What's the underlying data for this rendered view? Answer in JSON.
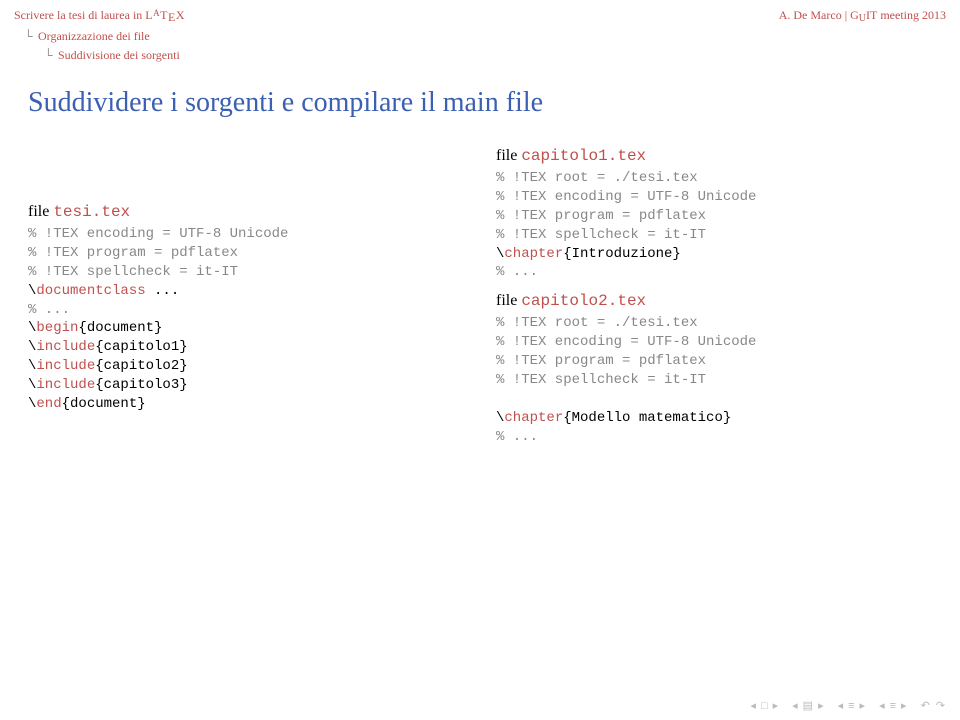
{
  "header": {
    "left_prefix": "Scrivere la tesi di laurea in ",
    "latex": "LATEX",
    "right": "A. De Marco | GuIT meeting 2013"
  },
  "breadcrumb": {
    "level1": "Organizzazione dei file",
    "level2": "Suddivisione dei sorgenti"
  },
  "title": "Suddividere i sorgenti e compilare il main file",
  "left": {
    "file_label": "file ",
    "file_name": "tesi.tex",
    "code_lines": [
      {
        "t": "% !TEX encoding = UTF-8 Unicode",
        "cls": "c-grey"
      },
      {
        "t": "% !TEX program = pdflatex",
        "cls": "c-grey"
      },
      {
        "t": "% !TEX spellcheck = it-IT",
        "cls": "c-grey"
      },
      {
        "pre": "\\",
        "cmd": "documentclass",
        "post": " ...",
        "cls": "c-red"
      },
      {
        "t": "% ...",
        "cls": "c-grey"
      },
      {
        "pre": "\\",
        "cmd": "begin",
        "post": "{document}",
        "cls": "c-red"
      },
      {
        "pre": "\\",
        "cmd": "include",
        "post": "{capitolo1}",
        "cls": "c-red"
      },
      {
        "pre": "\\",
        "cmd": "include",
        "post": "{capitolo2}",
        "cls": "c-red"
      },
      {
        "pre": "\\",
        "cmd": "include",
        "post": "{capitolo3}",
        "cls": "c-red"
      },
      {
        "pre": "\\",
        "cmd": "end",
        "post": "{document}",
        "cls": "c-red"
      }
    ]
  },
  "right": {
    "file1_label": "file ",
    "file1_name": "capitolo1.tex",
    "code1_lines": [
      {
        "t": "% !TEX root = ./tesi.tex",
        "cls": "c-grey"
      },
      {
        "t": "% !TEX encoding = UTF-8 Unicode",
        "cls": "c-grey"
      },
      {
        "t": "% !TEX program = pdflatex",
        "cls": "c-grey"
      },
      {
        "t": "% !TEX spellcheck = it-IT",
        "cls": "c-grey"
      },
      {
        "pre": "\\",
        "cmd": "chapter",
        "post": "{Introduzione}",
        "cls": "c-red"
      },
      {
        "t": "% ...",
        "cls": "c-grey"
      }
    ],
    "file2_label": "file ",
    "file2_name": "capitolo2.tex",
    "code2_lines": [
      {
        "t": "% !TEX root = ./tesi.tex",
        "cls": "c-grey"
      },
      {
        "t": "% !TEX encoding = UTF-8 Unicode",
        "cls": "c-grey"
      },
      {
        "t": "% !TEX program = pdflatex",
        "cls": "c-grey"
      },
      {
        "t": "% !TEX spellcheck = it-IT",
        "cls": "c-grey"
      },
      {
        "t": "",
        "cls": ""
      },
      {
        "pre": "\\",
        "cmd": "chapter",
        "post": "{Modello matematico}",
        "cls": "c-red"
      },
      {
        "t": "% ...",
        "cls": "c-grey"
      }
    ]
  },
  "nav": {
    "icons": [
      "□",
      "▤",
      "≡",
      "≡"
    ],
    "arrows_left": "◂",
    "arrows_right": "▸",
    "back": "↶",
    "menu": "☰"
  }
}
